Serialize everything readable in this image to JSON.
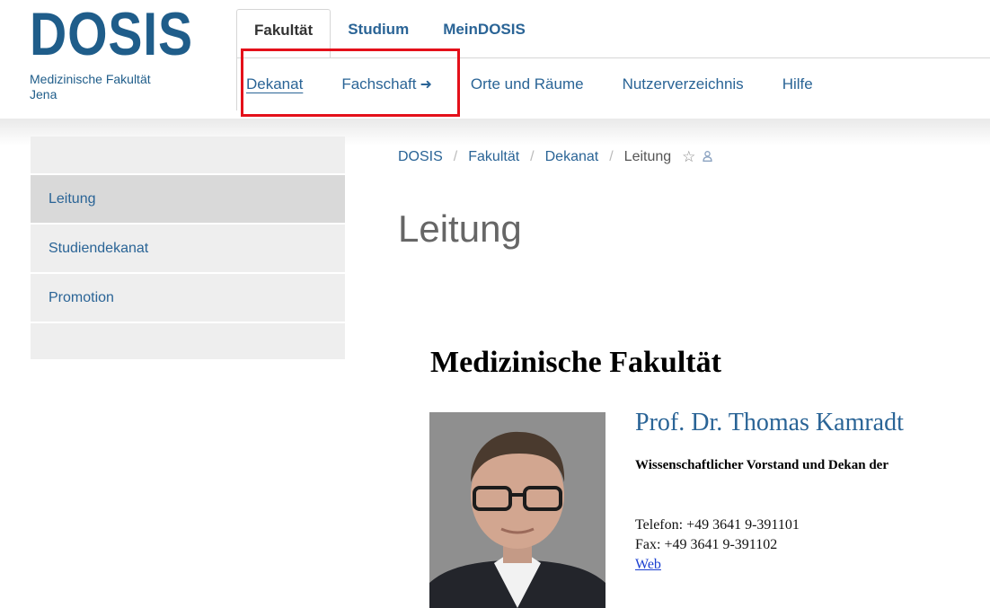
{
  "logo": {
    "mark": "DOSIS",
    "subtitle_line1": "Medizinische Fakultät",
    "subtitle_line2": "Jena"
  },
  "top_tabs": [
    {
      "label": "Fakultät",
      "active": true
    },
    {
      "label": "Studium",
      "active": false
    },
    {
      "label": "MeinDOSIS",
      "active": false
    }
  ],
  "sub_nav": [
    {
      "label": "Dekanat",
      "current": true
    },
    {
      "label": "Fachschaft",
      "external": true
    },
    {
      "label": "Orte und Räume"
    },
    {
      "label": "Nutzerverzeichnis"
    },
    {
      "label": "Hilfe"
    }
  ],
  "breadcrumb": {
    "items": [
      "DOSIS",
      "Fakultät",
      "Dekanat"
    ],
    "current": "Leitung",
    "separator": "/"
  },
  "sidebar": {
    "items": [
      {
        "label": "Leitung",
        "active": true
      },
      {
        "label": "Studiendekanat"
      },
      {
        "label": "Promotion"
      }
    ]
  },
  "page_title": "Leitung",
  "section_heading": "Medizinische Fakultät",
  "person": {
    "name": "Prof. Dr. Thomas Kamradt",
    "role": "Wissenschaftlicher Vorstand und Dekan der",
    "phone": "Telefon: +49 3641 9-391101",
    "fax": "Fax: +49 3641 9-391102",
    "web_label": "Web"
  },
  "colors": {
    "brand": "#1f5d8a",
    "link": "#2a6496",
    "highlight": "#e4101a"
  },
  "icons": {
    "external": "arrow-right-icon",
    "favorite": "star-icon",
    "user": "user-icon"
  }
}
